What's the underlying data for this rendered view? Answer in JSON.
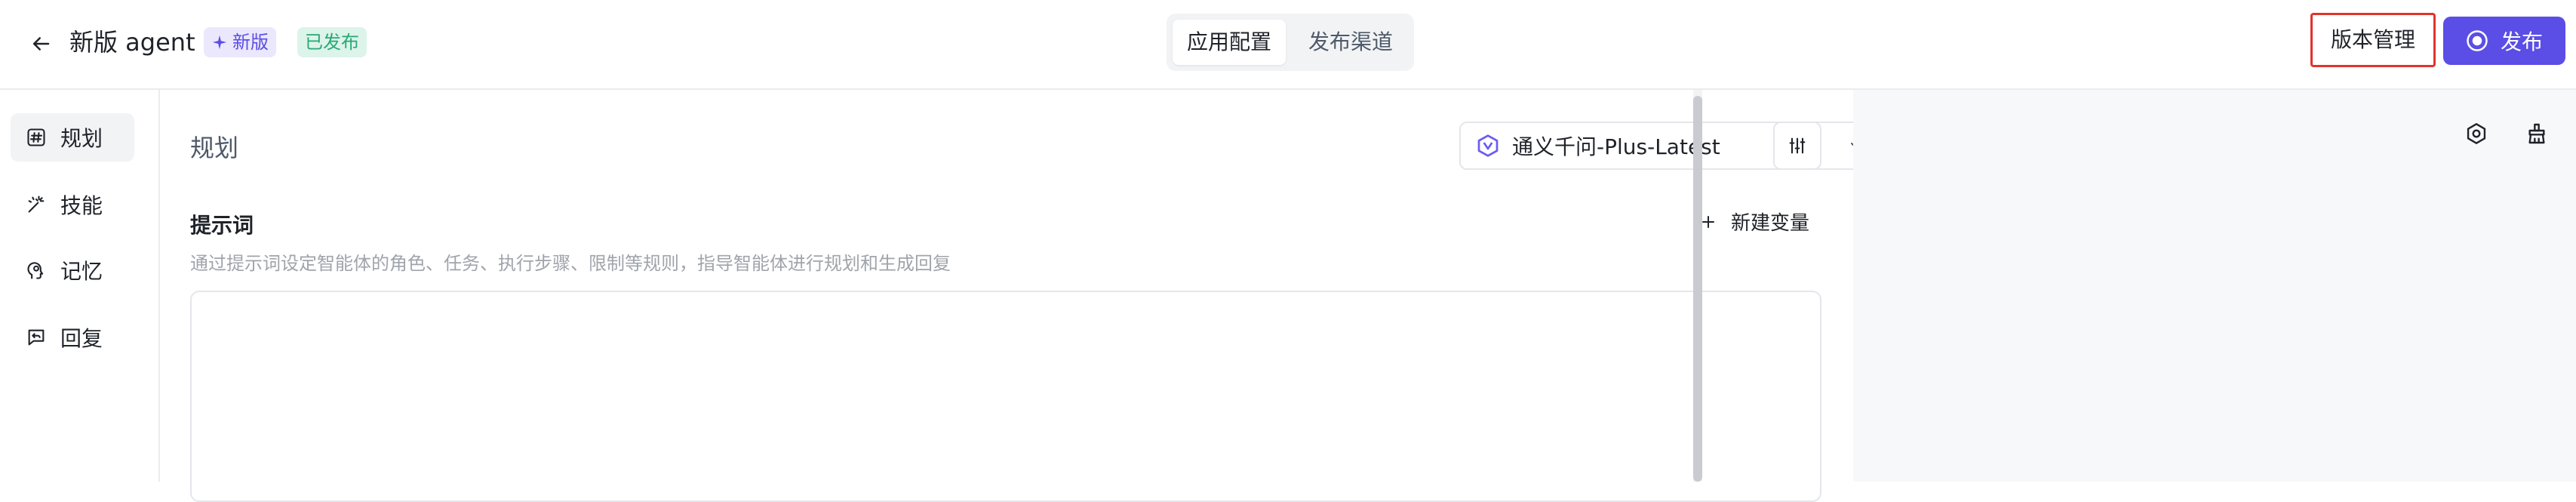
{
  "header": {
    "title": "新版 agent",
    "badge_new": "新版",
    "badge_published": "已发布",
    "tabs": [
      {
        "label": "应用配置",
        "active": true
      },
      {
        "label": "发布渠道",
        "active": false
      }
    ],
    "version_button": "版本管理",
    "publish_button": "发布"
  },
  "sidebar": {
    "items": [
      {
        "label": "规划",
        "icon": "hash-icon",
        "active": true
      },
      {
        "label": "技能",
        "icon": "magic-wand-icon",
        "active": false
      },
      {
        "label": "记忆",
        "icon": "brain-head-icon",
        "active": false
      },
      {
        "label": "回复",
        "icon": "reply-chat-icon",
        "active": false
      }
    ]
  },
  "main": {
    "section_title": "规划",
    "model": {
      "name": "通义千问-Plus-Latest",
      "icon": "qwen-logo-icon"
    },
    "prompt": {
      "title": "提示词",
      "add_variable": "新建变量",
      "description": "通过提示词设定智能体的角色、任务、执行步骤、限制等规则，指导智能体进行规划和生成回复",
      "value": ""
    }
  },
  "colors": {
    "accent": "#5b4ee6",
    "highlight_border": "#e0342c",
    "published_badge": "#2aa876"
  }
}
